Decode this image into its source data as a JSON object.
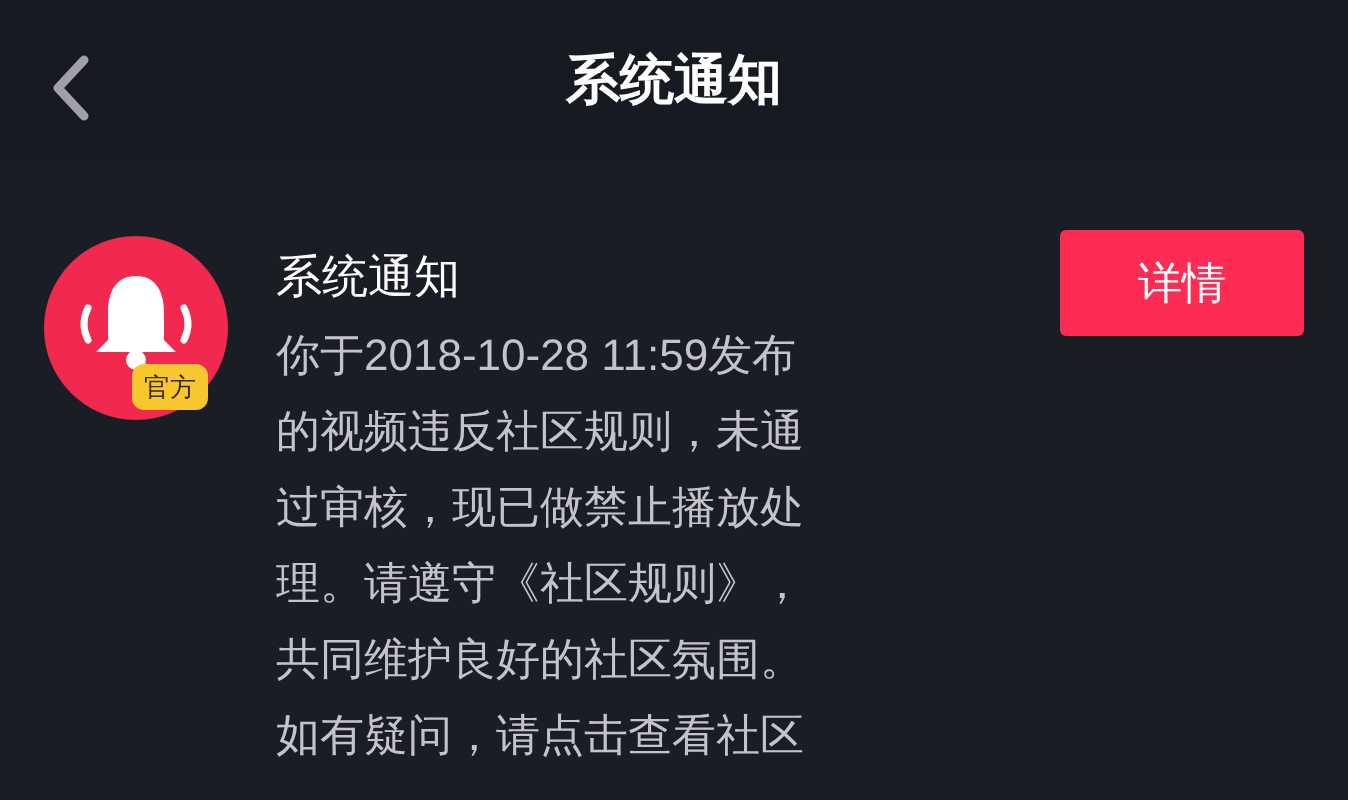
{
  "header": {
    "title": "系统通知"
  },
  "notification": {
    "badge": "官方",
    "sender": "系统通知",
    "message_lines": [
      "你于2018-10-28 11:59发布",
      "的视频违反社区规则，未通",
      "过审核，现已做禁止播放处",
      "理。请遵守《社区规则》，",
      "共同维护良好的社区氛围。",
      "如有疑问，请点击查看社区"
    ],
    "button": "详情"
  }
}
